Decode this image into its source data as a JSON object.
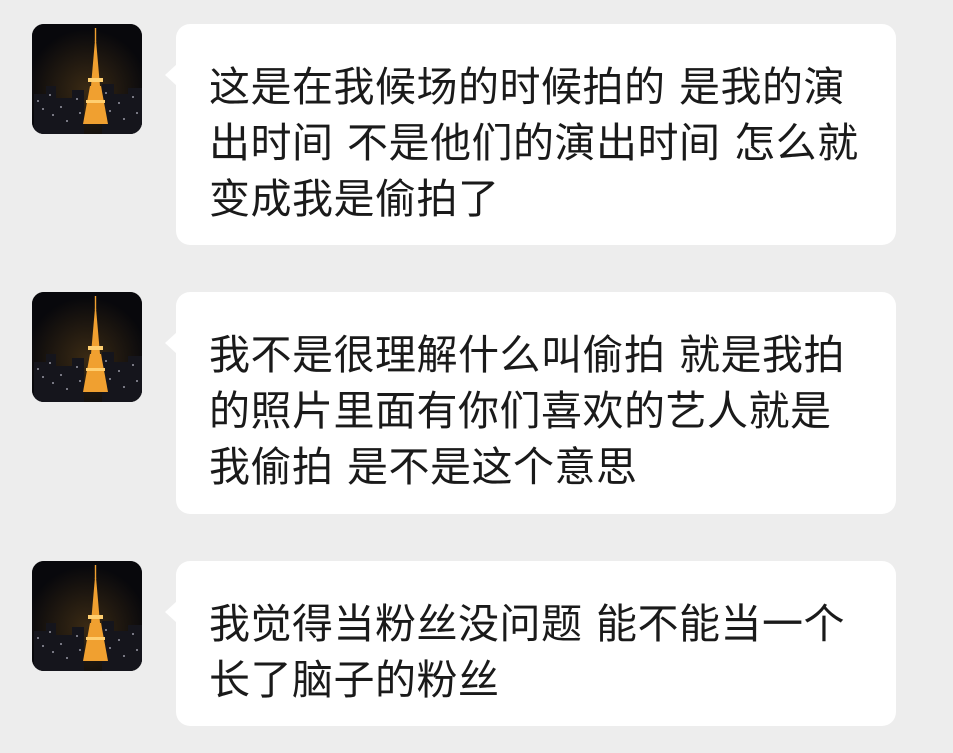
{
  "messages": [
    {
      "text": "这是在我候场的时候拍的 是我的演出时间 不是他们的演出时间 怎么就变成我是偷拍了",
      "avatar_icon": "tokyo-tower-night-icon"
    },
    {
      "text": "我不是很理解什么叫偷拍 就是我拍的照片里面有你们喜欢的艺人就是我偷拍 是不是这个意思",
      "avatar_icon": "tokyo-tower-night-icon"
    },
    {
      "text": "我觉得当粉丝没问题 能不能当一个长了脑子的粉丝",
      "avatar_icon": "tokyo-tower-night-icon"
    }
  ],
  "colors": {
    "background": "#ededed",
    "bubble": "#ffffff",
    "text": "#1a1a1a",
    "tower": "#f0a030"
  }
}
